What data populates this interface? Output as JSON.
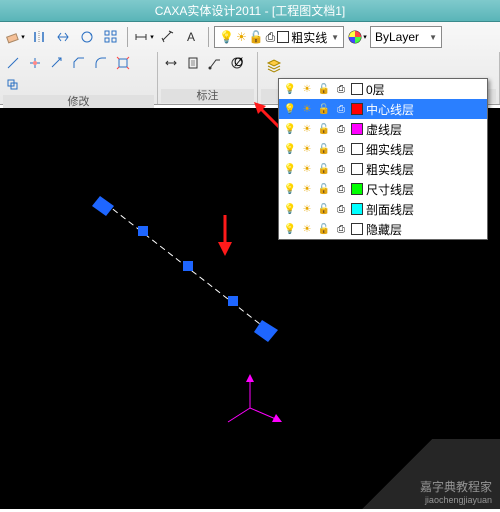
{
  "title": "CAXA实体设计2011 - [工程图文档1]",
  "panels": {
    "modify": "修改",
    "annotate": "标注"
  },
  "layer_combo": {
    "current": "粗实线"
  },
  "linetype_combo": {
    "value": "ByLayer"
  },
  "layers": [
    {
      "name": "0层",
      "color": "#ffffff"
    },
    {
      "name": "中心线层",
      "color": "#ff0000"
    },
    {
      "name": "虚线层",
      "color": "#ff00ff"
    },
    {
      "name": "细实线层",
      "color": "#ffffff"
    },
    {
      "name": "粗实线层",
      "color": "#ffffff"
    },
    {
      "name": "尺寸线层",
      "color": "#00ff00"
    },
    {
      "name": "剖面线层",
      "color": "#00ffff"
    },
    {
      "name": "隐藏层",
      "color": "#ffffff"
    }
  ],
  "selected_layer_index": 1,
  "watermark": {
    "line1": "嘉字典教程家",
    "line2": "jiaochengjiayuan"
  }
}
